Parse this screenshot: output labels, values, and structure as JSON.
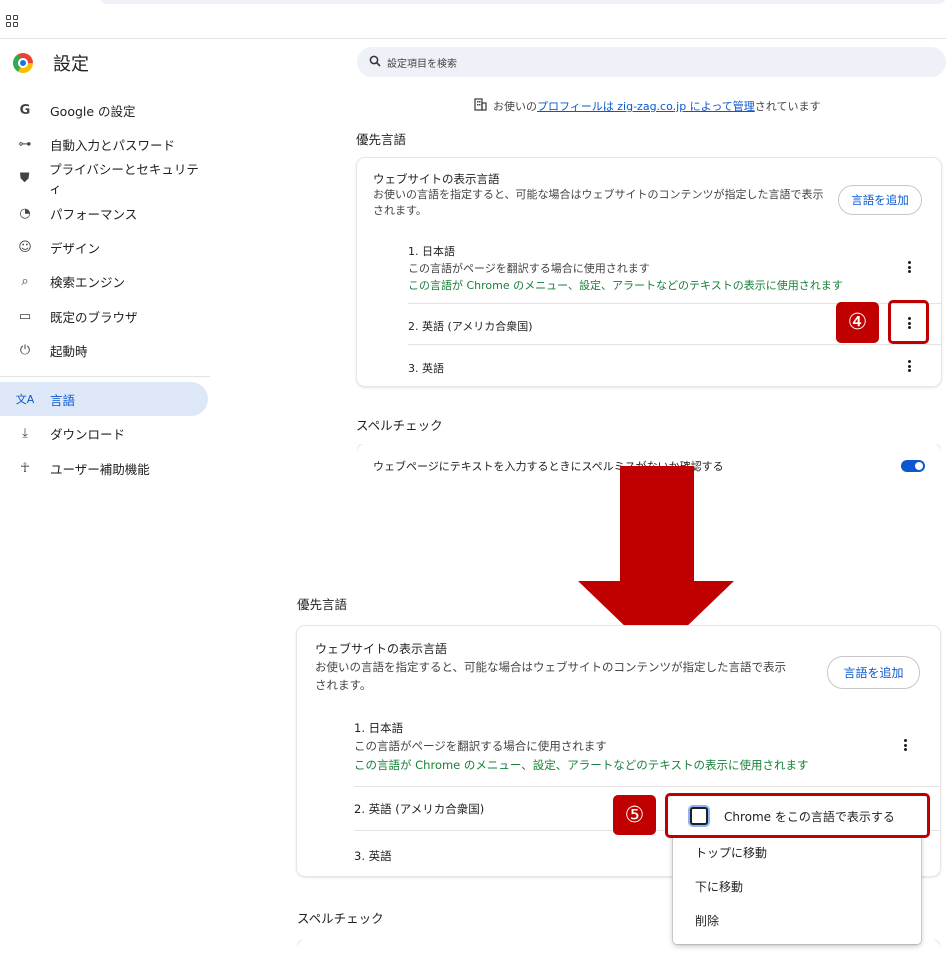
{
  "app": {
    "title": "設定"
  },
  "sidebar": {
    "items": [
      {
        "label": "Google の設定",
        "icon": "G"
      },
      {
        "label": "自動入力とパスワード",
        "icon": "⊶"
      },
      {
        "label": "プライバシーとセキュリティ",
        "icon": "⛊"
      },
      {
        "label": "パフォーマンス",
        "icon": "◔"
      },
      {
        "label": "デザイン",
        "icon": "☺"
      },
      {
        "label": "検索エンジン",
        "icon": "⌕"
      },
      {
        "label": "既定のブラウザ",
        "icon": "▭"
      },
      {
        "label": "起動時",
        "icon": "⏻"
      },
      {
        "label": "言語",
        "icon": "文A"
      },
      {
        "label": "ダウンロード",
        "icon": "⤓"
      },
      {
        "label": "ユーザー補助機能",
        "icon": "☥"
      }
    ]
  },
  "search": {
    "placeholder": "設定項目を検索"
  },
  "managed": {
    "prefix": "お使いの",
    "link": "プロフィールは zig-zag.co.jp によって管理",
    "suffix": "されています"
  },
  "top": {
    "section_languages": "優先言語",
    "card_title": "ウェブサイトの表示言語",
    "card_desc_line1": "お使いの言語を指定すると、可能な場合はウェブサイトのコンテンツが指定した言語で表示",
    "card_desc_line2": "されます。",
    "add_button": "言語を追加",
    "languages": [
      {
        "name": "1. 日本語",
        "sub": "この言語がページを翻訳する場合に使用されます",
        "green": "この言語が Chrome のメニュー、設定、アラートなどのテキストの表示に使用されます"
      },
      {
        "name": "2. 英語 (アメリカ合衆国)"
      },
      {
        "name": "3. 英語"
      }
    ],
    "badge": "④",
    "section_spell": "スペルチェック",
    "spell_row": "ウェブページにテキストを入力するときにスペルミスがないか確認する",
    "spell_enabled": true
  },
  "bottom": {
    "section_languages": "優先言語",
    "card_title": "ウェブサイトの表示言語",
    "card_desc_line1": "お使いの言語を指定すると、可能な場合はウェブサイトのコンテンツが指定した言語で表示",
    "card_desc_line2": "されます。",
    "add_button": "言語を追加",
    "languages": [
      {
        "name": "1. 日本語",
        "sub": "この言語がページを翻訳する場合に使用されます",
        "green": "この言語が Chrome のメニュー、設定、アラートなどのテキストの表示に使用されます"
      },
      {
        "name": "2. 英語 (アメリカ合衆国)"
      },
      {
        "name": "3. 英語"
      }
    ],
    "badge": "⑤",
    "section_spell": "スペルチェック",
    "menu": {
      "checkbox_label": "Chrome をこの言語で表示する",
      "checkbox_checked": false,
      "items": [
        "トップに移動",
        "下に移動",
        "削除"
      ]
    }
  },
  "colors": {
    "accent": "#0b57d0",
    "annotation": "#c00000",
    "green": "#188038"
  }
}
